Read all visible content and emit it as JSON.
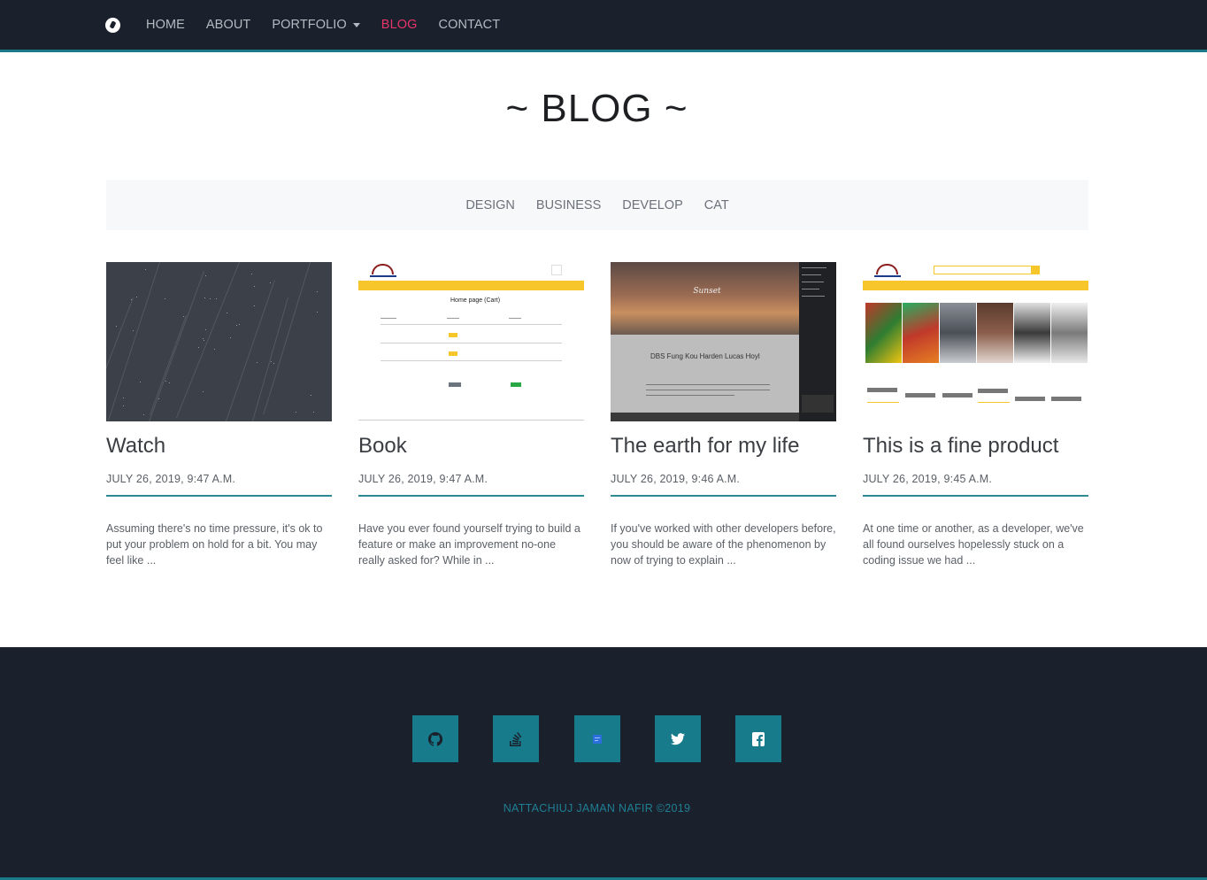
{
  "nav": {
    "brand_icon": "logo-icon",
    "items": [
      {
        "label": "HOME",
        "active": false
      },
      {
        "label": "ABOUT",
        "active": false
      },
      {
        "label": "PORTFOLIO",
        "active": false,
        "dropdown": true
      },
      {
        "label": "BLOG",
        "active": true
      },
      {
        "label": "CONTACT",
        "active": false
      }
    ]
  },
  "page": {
    "title": "~ BLOG ~"
  },
  "categories": [
    "DESIGN",
    "BUSINESS",
    "DEVELOP",
    "CAT"
  ],
  "posts": [
    {
      "title": "Watch",
      "date": "JULY 26, 2019, 9:47 A.M.",
      "excerpt": "Assuming there's no time pressure, it's ok to put your problem on hold for a bit. You may feel like ..."
    },
    {
      "title": "Book",
      "date": "JULY 26, 2019, 9:47 A.M.",
      "excerpt": "Have you ever found yourself trying to build a feature or make an improvement no-one really asked for? While in ...",
      "thumb_heading": "Home page (Cart)"
    },
    {
      "title": "The earth for my life",
      "date": "JULY 26, 2019, 9:46 A.M.",
      "excerpt": "If you've worked with other developers before, you should be aware of the phenomenon by now of trying to explain ...",
      "thumb_heading": "Sunset",
      "thumb_post": "DBS Fung Kou Harden Lucas Hoyl"
    },
    {
      "title": "This is a fine product",
      "date": "JULY 26, 2019, 9:45 A.M.",
      "excerpt": "At one time or another, as a developer, we've all found ourselves hopelessly stuck on a coding issue we had ..."
    }
  ],
  "footer": {
    "social": [
      {
        "name": "github",
        "icon": "github-icon"
      },
      {
        "name": "stackoverflow",
        "icon": "stackoverflow-icon"
      },
      {
        "name": "blog",
        "icon": "blog-icon"
      },
      {
        "name": "twitter",
        "icon": "twitter-icon"
      },
      {
        "name": "facebook",
        "icon": "facebook-icon"
      }
    ],
    "copyright": "NATTACHIUJ JAMAN NAFIR ©2019"
  },
  "colors": {
    "nav_bg": "#1b212c",
    "accent": "#1a7a8a",
    "active_link": "#e8346b",
    "footer_text": "#1f7f93",
    "social_bg": "#177b8c"
  }
}
